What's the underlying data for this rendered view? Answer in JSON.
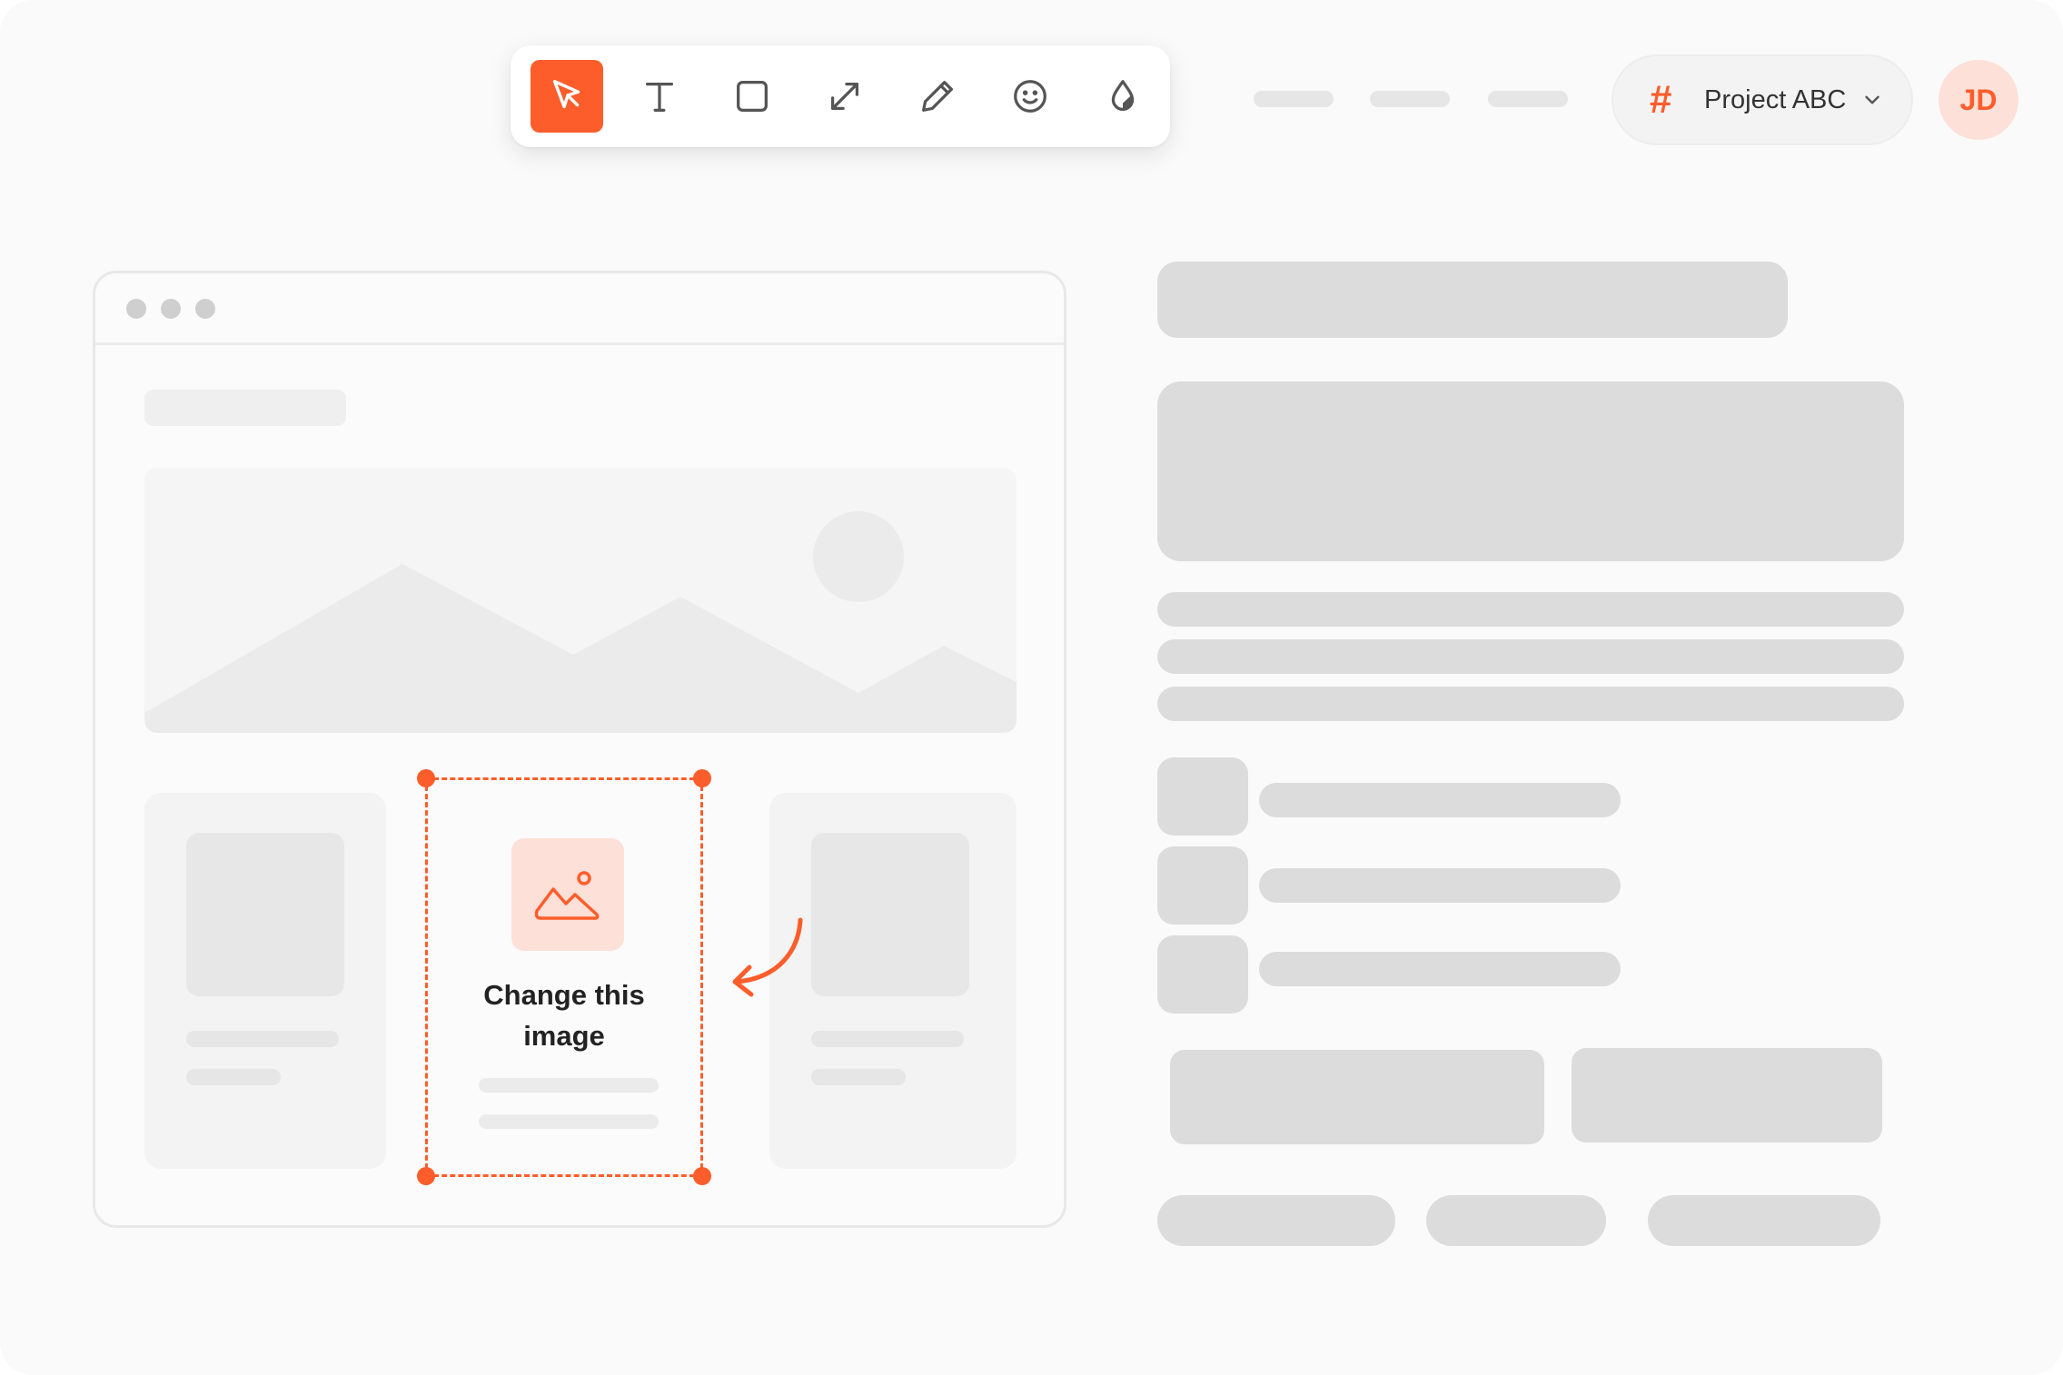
{
  "toolbar": {
    "tools": [
      {
        "icon": "cursor-icon",
        "active": true
      },
      {
        "icon": "text-icon",
        "active": false
      },
      {
        "icon": "rectangle-icon",
        "active": false
      },
      {
        "icon": "resize-icon",
        "active": false
      },
      {
        "icon": "pencil-icon",
        "active": false
      },
      {
        "icon": "emoji-icon",
        "active": false
      },
      {
        "icon": "droplet-icon",
        "active": false
      }
    ]
  },
  "project": {
    "icon": "hash-icon",
    "hash": "#",
    "label": "Project ABC",
    "dropdown_icon": "chevron-down-icon"
  },
  "avatar": {
    "initials": "JD"
  },
  "selection": {
    "icon": "image-icon",
    "line1": "Change this",
    "line2": "image",
    "arrow_icon": "curved-arrow-icon"
  },
  "colors": {
    "accent": "#fd5d2b",
    "accent_light": "#fde0d7",
    "skeleton": "#dcdcdc"
  }
}
